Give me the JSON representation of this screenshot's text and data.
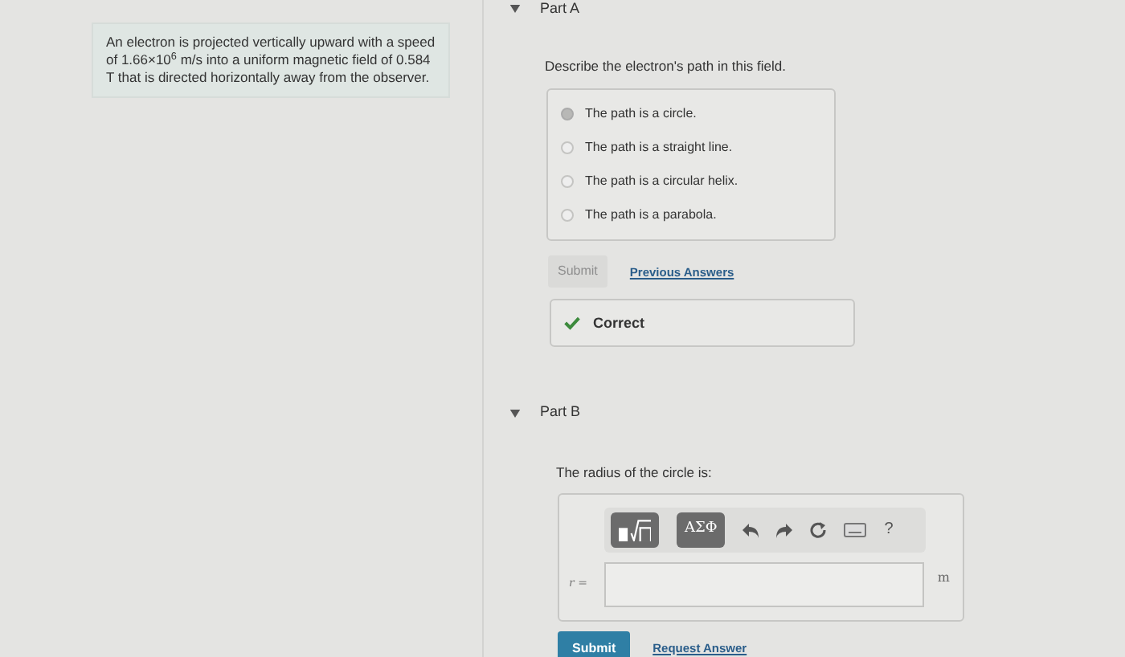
{
  "problem": {
    "text": "An electron is projected vertically upward with a speed of 1.66×10$^{6}$ m/s into a uniform magnetic field of 0.584 T that is directed horizontally away from the observer."
  },
  "part_a": {
    "title": "Part A",
    "expanded": true,
    "question": "Describe the electron's path in this field.",
    "options": [
      {
        "label": "The path is a circle.",
        "selected": true
      },
      {
        "label": "The path is a straight line.",
        "selected": false
      },
      {
        "label": "The path is a circular helix.",
        "selected": false
      },
      {
        "label": "The path is a parabola.",
        "selected": false
      }
    ],
    "submit": {
      "label": "Submit",
      "disabled": true
    },
    "link": "Previous Answers",
    "feedback": {
      "kind": "correct",
      "text": "Correct"
    }
  },
  "part_b": {
    "title": "Part B",
    "expanded": true,
    "question": "The radius of the circle is:",
    "toolbar": [
      {
        "kind": "templates"
      },
      {
        "kind": "symbols",
        "label": "ΑΣΦ"
      },
      {
        "kind": "undo"
      },
      {
        "kind": "redo"
      },
      {
        "kind": "reset"
      },
      {
        "kind": "keyboard"
      },
      {
        "kind": "help",
        "label": "?"
      }
    ],
    "variable": "r =",
    "unit": "m",
    "submit": {
      "label": "Submit",
      "disabled": false
    },
    "link": "Request Answer"
  }
}
